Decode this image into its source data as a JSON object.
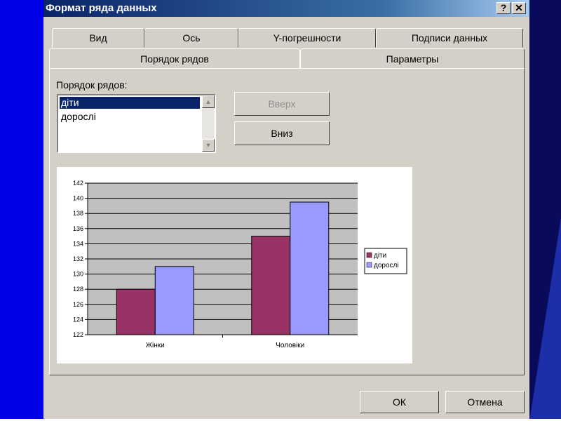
{
  "window": {
    "title": "Формат ряда данных",
    "help_label": "?",
    "close_label": "✕"
  },
  "tabs": {
    "row1": [
      {
        "label": "Вид"
      },
      {
        "label": "Ось"
      },
      {
        "label": "Y-погрешности"
      },
      {
        "label": "Подписи данных"
      }
    ],
    "row2": [
      {
        "label": "Порядок рядов",
        "active": true
      },
      {
        "label": "Параметры"
      }
    ]
  },
  "series_order": {
    "label": "Порядок рядов:",
    "items": [
      {
        "label": "діти",
        "selected": true
      },
      {
        "label": "дорослі",
        "selected": false
      }
    ],
    "scroll_up_icon": "arrow-up-icon",
    "scroll_down_icon": "arrow-down-icon",
    "up_button": {
      "label": "Вверх",
      "enabled": false
    },
    "down_button": {
      "label": "Вниз",
      "enabled": true
    }
  },
  "buttons": {
    "ok": "ОК",
    "cancel": "Отмена"
  },
  "chart_data": {
    "type": "bar",
    "categories": [
      "Жінки",
      "Чоловіки"
    ],
    "series": [
      {
        "name": "діти",
        "values": [
          128,
          135
        ],
        "color": "#993366"
      },
      {
        "name": "дорослі",
        "values": [
          131,
          139.5
        ],
        "color": "#9999ff"
      }
    ],
    "ylim": [
      122,
      142
    ],
    "yticks": [
      122,
      124,
      126,
      128,
      130,
      132,
      134,
      136,
      138,
      140,
      142
    ],
    "grid": true,
    "plot_background": "#c0c0c0",
    "legend_position": "right"
  }
}
